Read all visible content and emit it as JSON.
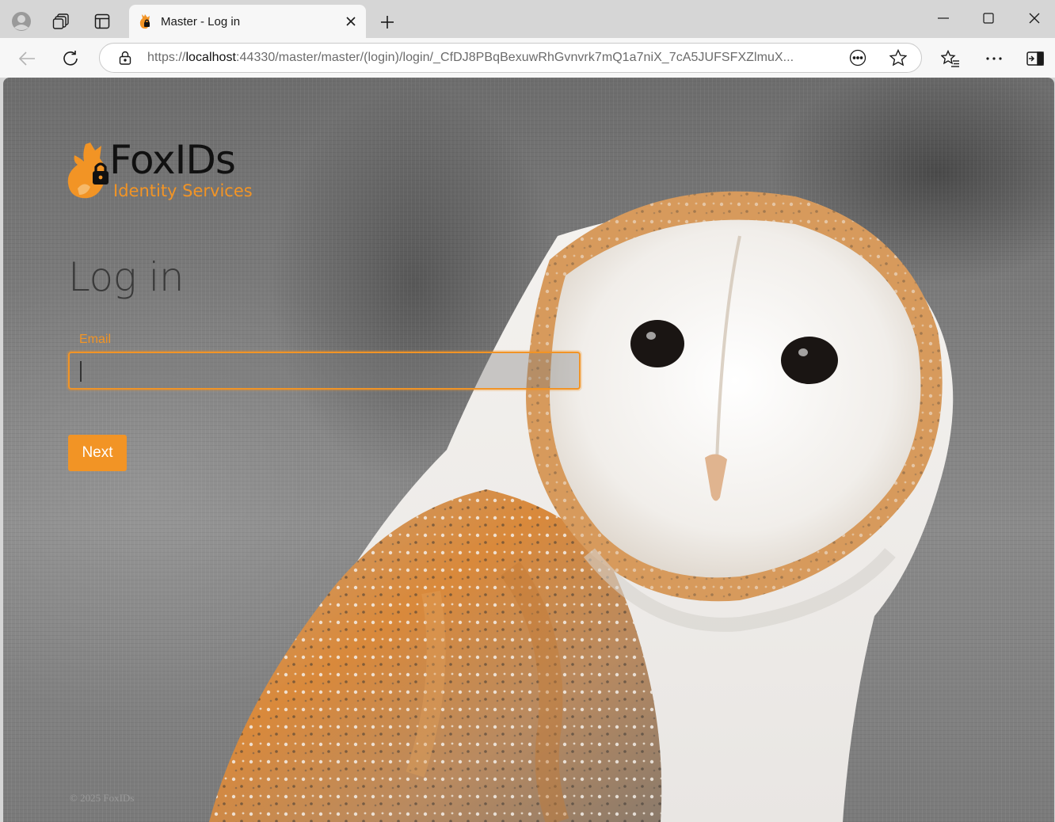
{
  "browser": {
    "tab": {
      "title": "Master - Log in"
    },
    "address": {
      "scheme": "https://",
      "host": "localhost",
      "rest": ":44330/master/master/(login)/login/_CfDJ8PBqBexuwRhGvnvrk7mQ1a7niX_7cA5JUFSFXZlmuX..."
    }
  },
  "brand": {
    "name": "FoxIDs",
    "subtitle": "Identity Services"
  },
  "login": {
    "title": "Log in",
    "email_label": "Email",
    "email_value": "",
    "next_label": "Next"
  },
  "footer": {
    "copyright": "© 2025 FoxIDs"
  },
  "colors": {
    "accent": "#f29425",
    "tab_active": "#f7f7f7",
    "tab_strip": "#d6d6d6"
  }
}
